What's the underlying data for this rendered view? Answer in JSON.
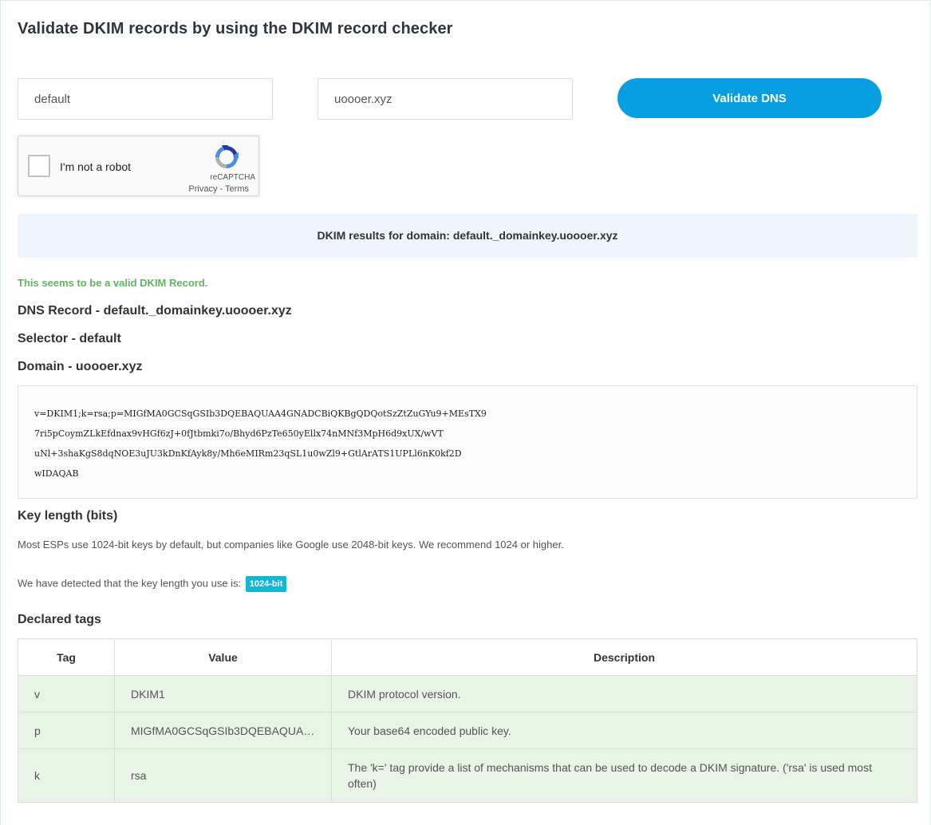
{
  "page": {
    "title": "Validate DKIM records by using the DKIM record checker"
  },
  "form": {
    "selector_value": "default",
    "domain_value": "uoooer.xyz",
    "validate_label": "Validate DNS"
  },
  "recaptcha": {
    "label": "I'm not a robot",
    "brand": "reCAPTCHA",
    "privacy": "Privacy",
    "sep": " - ",
    "terms": "Terms"
  },
  "results": {
    "banner": "DKIM results for domain: default._domainkey.uoooer.xyz",
    "valid_message": "This seems to be a valid DKIM Record.",
    "dns_record": "DNS Record - default._domainkey.uoooer.xyz",
    "selector": "Selector - default",
    "domain": "Domain - uoooer.xyz",
    "record_lines": [
      "v=DKIM1;k=rsa;p=MIGfMA0GCSqGSIb3DQEBAQUAA4GNADCBiQKBgQDQotSzZtZuGYu9+MEsTX9",
      "7ri5pCoymZLkEfdnax9vHGf6zJ+0fJtbmki7o/Bhyd6PzTe650yEllx74nMNf3MpH6d9xUX/wVT",
      "uNl+3shaKgS8dqNOE3uJU3kDnKfAyk8y/Mh6eMIRm23qSL1u0wZl9+GtlArATS1UPLl6nK0kf2D",
      "wIDAQAB"
    ]
  },
  "key_length": {
    "heading": "Key length (bits)",
    "description": "Most ESPs use 1024-bit keys by default, but companies like Google use 2048-bit keys. We recommend 1024 or higher.",
    "detected_text": "We have detected that the key length you use is:",
    "badge": "1024-bit"
  },
  "tags": {
    "heading": "Declared tags",
    "headers": [
      "Tag",
      "Value",
      "Description"
    ],
    "rows": [
      {
        "tag": "v",
        "value": "DKIM1",
        "description": "DKIM protocol version."
      },
      {
        "tag": "p",
        "value": "MIGfMA0GCSqGSIb3DQEBAQUAA...",
        "description": "Your base64 encoded public key."
      },
      {
        "tag": "k",
        "value": "rsa",
        "description": "The 'k=' tag provide a list of mechanisms that can be used to decode a DKIM signature. ('rsa' is used most often)"
      }
    ]
  },
  "colors": {
    "primary_button": "#079fe2",
    "valid_green": "#5cb85c",
    "badge": "#14b6d3",
    "row_bg": "#e7f4e6",
    "banner_bg": "#eff5fc"
  }
}
